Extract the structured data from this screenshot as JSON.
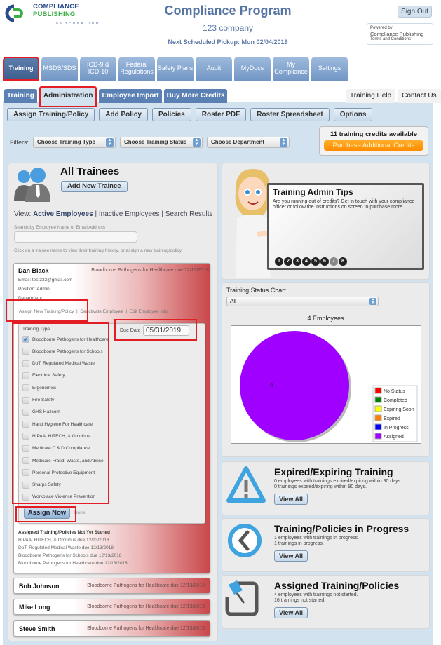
{
  "header": {
    "logo": {
      "main_a": "COMPLIANCE ",
      "main_b": "PUBLISHING",
      "sub": "CORPORATION"
    },
    "title": "Compliance Program",
    "company": "123 company",
    "pickup": "Next Scheduled Pickup: Mon 02/04/2019",
    "sign_out": "Sign Out",
    "powered": {
      "line1": "Powered by",
      "line2": "Compliance Publishing",
      "line3": "Terms and Conditions"
    }
  },
  "main_nav": [
    {
      "label": "Training",
      "active": true
    },
    {
      "label": "MSDS/SDS"
    },
    {
      "label": "ICD-9 & ICD-10"
    },
    {
      "label": "Federal Regulations"
    },
    {
      "label": "Safety Plans"
    },
    {
      "label": "Audit"
    },
    {
      "label": "MyDocs"
    },
    {
      "label": "My Compliance"
    },
    {
      "label": "Settings"
    }
  ],
  "sub_nav": [
    {
      "label": "Training"
    },
    {
      "label": "Administration",
      "active": true
    },
    {
      "label": "Employee Import"
    },
    {
      "label": "Buy More Credits"
    }
  ],
  "right_tabs": [
    {
      "label": "Training Help"
    },
    {
      "label": "Contact Us"
    }
  ],
  "toolbar": [
    "Assign Training/Policy",
    "Add Policy",
    "Policies",
    "Roster PDF",
    "Roster Spreadsheet",
    "Options"
  ],
  "filters": {
    "label": "Filters:",
    "selects": [
      "Choose Training Type",
      "Choose Training Status",
      "Choose Department"
    ]
  },
  "credits": {
    "text": "11 training credits available",
    "button": "Purchase Additional Credits"
  },
  "trainees": {
    "title": "All Trainees",
    "add_button": "Add New Trainee",
    "view_prefix": "View: ",
    "view_active": "Active Employees",
    "view_sep1": " | Inactive Employees | Search Results",
    "search_label": "Search by Employee Name or Email Address",
    "search_value": "",
    "hint": "Click on a trainee name to view their training history, or assign a new training/policy.",
    "expanded": {
      "name": "Dan Black",
      "due": "Bloodborne Pathogens for Healthcare due 12/13/2018",
      "email": "Email: test333@gmail.com",
      "position": "Position: Admin",
      "department": "Department:",
      "actions": [
        "Assign New Training/Policy",
        "Deactivate Employee",
        "Edit Employee Info"
      ],
      "training_type_label": "Training Type",
      "due_date_label": "Due Date",
      "due_date_value": "05/31/2019",
      "training_types": [
        {
          "label": "Bloodborne Pathogens for Healthcare",
          "checked": true
        },
        {
          "label": "Bloodborne Pathogens for Schools",
          "checked": false
        },
        {
          "label": "DoT: Regulated Medical Waste",
          "checked": false
        },
        {
          "label": "Electrical Safety",
          "checked": false
        },
        {
          "label": "Ergonomics",
          "checked": false
        },
        {
          "label": "Fire Safety",
          "checked": false
        },
        {
          "label": "GHS Hazcom",
          "checked": false
        },
        {
          "label": "Hand Hygiene For Healthcare",
          "checked": false
        },
        {
          "label": "HIPAA, HITECH, & Omnibus",
          "checked": false
        },
        {
          "label": "Medicare C & D Compliance",
          "checked": false
        },
        {
          "label": "Medicare Fraud, Waste, and Abuse",
          "checked": false
        },
        {
          "label": "Personal Protective Equipment",
          "checked": false
        },
        {
          "label": "Sharps Safety",
          "checked": false
        },
        {
          "label": "Workplace Violence Prevention",
          "checked": false
        }
      ],
      "assign_button": "Assign Now",
      "assign_note": "None",
      "not_started_title": "Assigned Training/Policies Not Yet Started",
      "not_started": [
        "HIPAA, HITECH, & Omnibus due 12/13/2018",
        "DoT: Regulated Medical Waste due 12/13/2018",
        "Bloodborne Pathogens for Schools due 12/13/2018",
        "Bloodborne Pathogens for Healthcare due 12/13/2018"
      ]
    },
    "others": [
      {
        "name": "Bob Johnson",
        "due": "Bloodborne Pathogens for Healthcare due 12/13/2018"
      },
      {
        "name": "Mike Long",
        "due": "Bloodborne Pathogens for Healthcare due 12/13/2018"
      },
      {
        "name": "Steve Smith",
        "due": "Bloodborne Pathogens for Healthcare due 12/13/2018"
      }
    ]
  },
  "tips": {
    "title": "Training Admin Tips",
    "body": "Are you running out of credits? Get in touch with your compliance officer or follow the instructions on screen to purchase more.",
    "pages": [
      "1",
      "2",
      "3",
      "4",
      "5",
      "6",
      "7",
      "8"
    ],
    "active_page": 7
  },
  "chart_data": {
    "type": "pie",
    "title": "Training Status Chart",
    "filter": "All",
    "subtitle": "4 Employees",
    "legend_position": "bottom-right",
    "categories": [
      "No Status",
      "Completed",
      "Expiring Soon",
      "Expired",
      "In Progress",
      "Assigned"
    ],
    "colors": [
      "#ff0000",
      "#008000",
      "#ffff00",
      "#ff8000",
      "#0000ff",
      "#a000ff"
    ],
    "values": [
      0,
      0,
      0,
      0,
      0,
      4
    ],
    "data_labels": [
      "",
      "",
      "",
      "",
      "",
      "4"
    ]
  },
  "info_boxes": [
    {
      "icon": "warning-icon",
      "title": "Expired/Expiring Training",
      "lines": [
        "0 employees with trainings expired/expiring within 90 days.",
        "0 trainings expired/expiring within 90 days."
      ],
      "button": "View All"
    },
    {
      "icon": "clock-icon",
      "title": "Training/Policies in Progress",
      "lines": [
        "1 employees with trainings in progress.",
        "1 trainings in progress."
      ],
      "button": "View All"
    },
    {
      "icon": "pin-icon",
      "title": "Assigned Training/Policies",
      "lines": [
        "4 employees with trainings not started.",
        "16 trainings not started."
      ],
      "button": "View All"
    }
  ]
}
